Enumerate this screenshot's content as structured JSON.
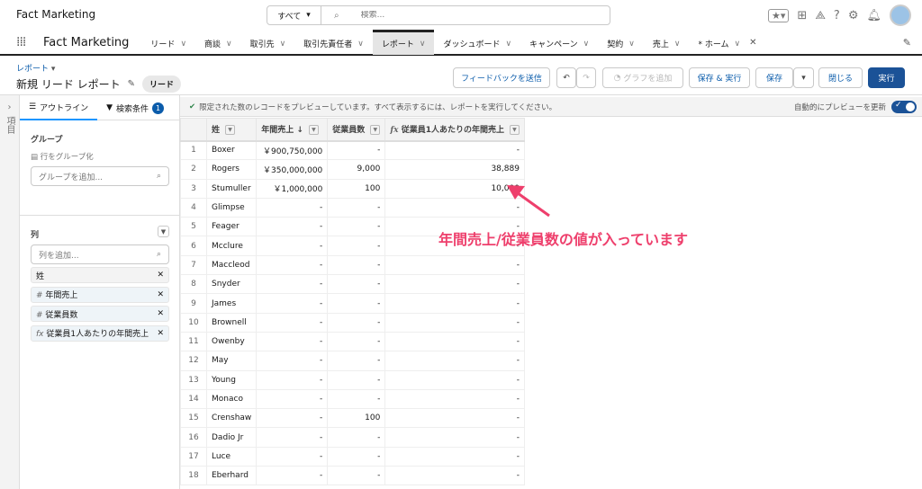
{
  "header": {
    "app_title": "Fact Marketing",
    "search_scope": "すべて",
    "search_placeholder": "検索..."
  },
  "nav": {
    "app_name": "Fact Marketing",
    "tabs": [
      {
        "label": "リード",
        "active": false
      },
      {
        "label": "商談",
        "active": false
      },
      {
        "label": "取引先",
        "active": false
      },
      {
        "label": "取引先責任者",
        "active": false
      },
      {
        "label": "レポート",
        "active": true
      },
      {
        "label": "ダッシュボード",
        "active": false
      },
      {
        "label": "キャンペーン",
        "active": false
      },
      {
        "label": "契約",
        "active": false
      },
      {
        "label": "売上",
        "active": false
      },
      {
        "label": "* ホーム",
        "active": false
      }
    ]
  },
  "page": {
    "breadcrumb": "レポート",
    "title": "新規 リード レポート",
    "report_type": "リード"
  },
  "buttons": {
    "feedback": "フィードバックを送信",
    "add_chart": "グラフを追加",
    "save_run": "保存 & 実行",
    "save": "保存",
    "close": "閉じる",
    "run": "実行"
  },
  "strip": {
    "label": "項目"
  },
  "sidebar": {
    "tab_outline": "アウトライン",
    "tab_filters": "検索条件",
    "filter_count": "1",
    "group_label": "グループ",
    "group_rows": "行をグループ化",
    "group_placeholder": "グループを追加...",
    "columns_label": "列",
    "columns_placeholder": "列を追加...",
    "columns": [
      {
        "prefix": "",
        "label": "姓"
      },
      {
        "prefix": "#",
        "label": "年間売上"
      },
      {
        "prefix": "#",
        "label": "従業員数"
      },
      {
        "prefix": "fx",
        "label": "従業員1人あたりの年間売上"
      }
    ]
  },
  "preview": {
    "message": "限定された数のレコードをプレビューしています。すべて表示するには、レポートを実行してください。",
    "auto_update": "自動的にプレビューを更新",
    "auto_update_on": true
  },
  "table": {
    "headers": [
      "姓",
      "年間売上 ↓",
      "従業員数",
      "従業員1人あたりの年間売上"
    ],
    "rows": [
      [
        "1",
        "Boxer",
        "￥900,750,000",
        "-",
        "-"
      ],
      [
        "2",
        "Rogers",
        "￥350,000,000",
        "9,000",
        "38,889"
      ],
      [
        "3",
        "Stumuller",
        "￥1,000,000",
        "100",
        "10,000"
      ],
      [
        "4",
        "Glimpse",
        "-",
        "-",
        "-"
      ],
      [
        "5",
        "Feager",
        "-",
        "-",
        "-"
      ],
      [
        "6",
        "Mcclure",
        "-",
        "-",
        "-"
      ],
      [
        "7",
        "Maccleod",
        "-",
        "-",
        "-"
      ],
      [
        "8",
        "Snyder",
        "-",
        "-",
        "-"
      ],
      [
        "9",
        "James",
        "-",
        "-",
        "-"
      ],
      [
        "10",
        "Brownell",
        "-",
        "-",
        "-"
      ],
      [
        "11",
        "Owenby",
        "-",
        "-",
        "-"
      ],
      [
        "12",
        "May",
        "-",
        "-",
        "-"
      ],
      [
        "13",
        "Young",
        "-",
        "-",
        "-"
      ],
      [
        "14",
        "Monaco",
        "-",
        "-",
        "-"
      ],
      [
        "15",
        "Crenshaw",
        "-",
        "100",
        "-"
      ],
      [
        "16",
        "Dadio Jr",
        "-",
        "-",
        "-"
      ],
      [
        "17",
        "Luce",
        "-",
        "-",
        "-"
      ],
      [
        "18",
        "Eberhard",
        "-",
        "-",
        "-"
      ]
    ]
  },
  "annotation": {
    "text": "年間売上/従業員数の値が入っています",
    "color": "#ee3f6c"
  }
}
